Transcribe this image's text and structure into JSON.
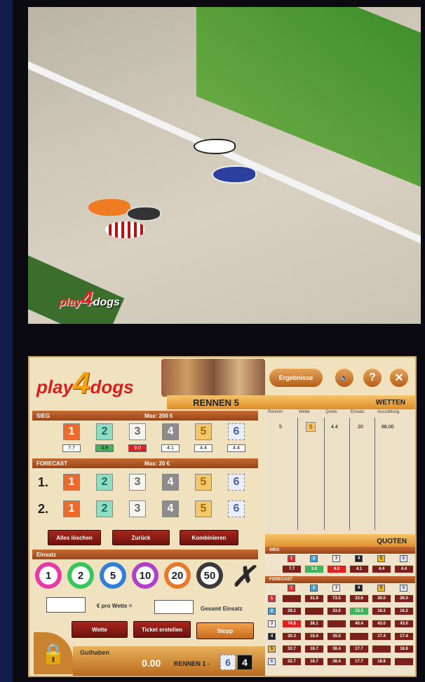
{
  "video": {
    "watermark_play": "play",
    "watermark_4": "4",
    "watermark_dogs": "dogs"
  },
  "header": {
    "logo_play": "play",
    "logo_4": "4",
    "logo_dogs": "dogs",
    "results_label": "Ergebnisse",
    "race_title": "RENNEN 5",
    "bets_title": "WETTEN",
    "icons": [
      "speaker-icon",
      "help-icon",
      "close-icon"
    ]
  },
  "sieg": {
    "label": "SIEG",
    "max": "Max: 200 €",
    "traps": [
      "1",
      "2",
      "3",
      "4",
      "5",
      "6"
    ],
    "odds": [
      "7.7",
      "3.9",
      "9.0",
      "4.1",
      "4.4",
      "4.4"
    ]
  },
  "forecast": {
    "label": "FORECAST",
    "max": "Max: 20 €",
    "row1": "1.",
    "row2": "2.",
    "traps": [
      "1",
      "2",
      "3",
      "4",
      "5",
      "6"
    ]
  },
  "actions": {
    "clear": "Alles löschen",
    "back": "Zurück",
    "combine": "Kombinieren"
  },
  "einsatz": {
    "label": "Einsatz",
    "chips": [
      "1",
      "2",
      "5",
      "10",
      "20",
      "50"
    ],
    "chip_colors": [
      "#e63aa6",
      "#35c75a",
      "#2f7ed8",
      "#b13fc9",
      "#e8782a",
      "#3a3a3a"
    ],
    "per_bet": "€ pro Wette =",
    "total": "Gesamt Einsatz"
  },
  "bottom_buttons": {
    "bet": "Wette",
    "ticket": "Ticket erstellen",
    "stop": "Stopp"
  },
  "footer": {
    "balance_label": "Guthaben",
    "balance_value": "0.00",
    "race_label": "RENNEN 1 -",
    "race_trap_6": "6",
    "race_trap_4": "4"
  },
  "bets_table": {
    "columns": [
      "Rennen",
      "Wette",
      "Quote",
      "Einsatz",
      "Auszahlung"
    ],
    "rows": [
      {
        "race": "5",
        "bet": "5",
        "odds": "4.4",
        "stake": "20",
        "payout": "88.00"
      }
    ]
  },
  "quoten": {
    "title": "QUOTEN",
    "sieg_label": "SIEG",
    "forecast_label": "FORECAST",
    "traps": [
      "1",
      "2",
      "3",
      "4",
      "5",
      "6"
    ],
    "sieg_values": [
      "7.7",
      "3.9",
      "9.0",
      "4.1",
      "4.4",
      "4.4"
    ],
    "forecast": [
      [
        "",
        "31.9",
        "73.5",
        "33.6",
        "36.0",
        "36.0"
      ],
      [
        "28.1",
        "",
        "33.0",
        "15.2",
        "16.2",
        "16.2"
      ],
      [
        "74.8",
        "38.1",
        "",
        "40.4",
        "43.0",
        "43.0"
      ],
      [
        "30.3",
        "15.4",
        "35.5",
        "",
        "17.4",
        "17.4"
      ],
      [
        "32.7",
        "16.7",
        "38.4",
        "17.7",
        "",
        "18.8"
      ],
      [
        "32.7",
        "16.7",
        "38.4",
        "17.7",
        "18.8",
        ""
      ]
    ]
  }
}
